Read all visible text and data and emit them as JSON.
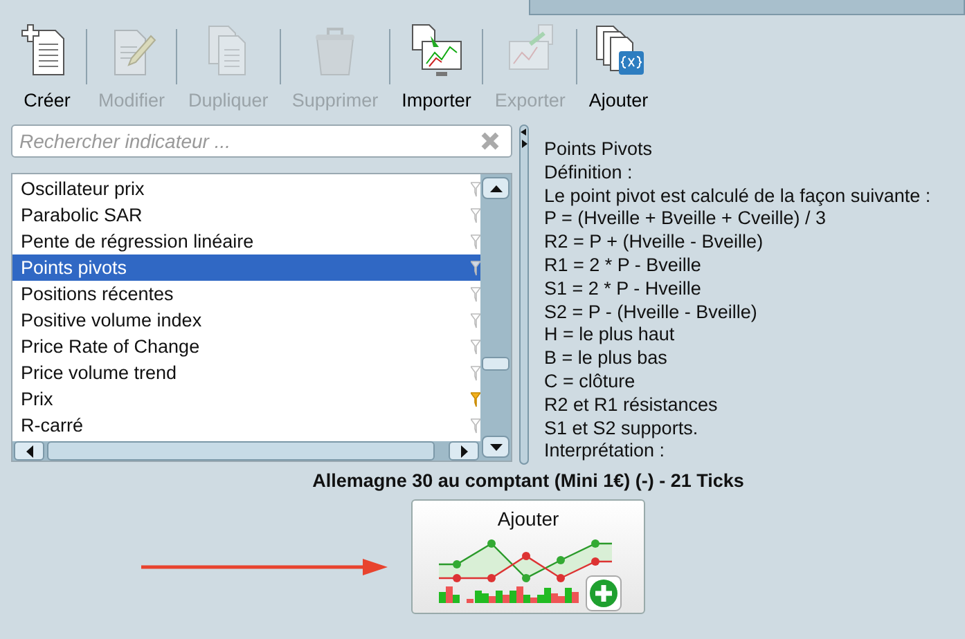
{
  "toolbar": [
    {
      "label": "Créer",
      "disabled": false
    },
    {
      "label": "Modifier",
      "disabled": true
    },
    {
      "label": "Dupliquer",
      "disabled": true
    },
    {
      "label": "Supprimer",
      "disabled": true
    },
    {
      "label": "Importer",
      "disabled": false
    },
    {
      "label": "Exporter",
      "disabled": true
    },
    {
      "label": "Ajouter",
      "disabled": false
    }
  ],
  "search": {
    "placeholder": "Rechercher indicateur ..."
  },
  "indicators": [
    {
      "name": "Oscillateur prix",
      "selected": false,
      "favorite": false
    },
    {
      "name": "Parabolic SAR",
      "selected": false,
      "favorite": false
    },
    {
      "name": "Pente de régression linéaire",
      "selected": false,
      "favorite": false
    },
    {
      "name": "Points pivots",
      "selected": true,
      "favorite": false
    },
    {
      "name": "Positions récentes",
      "selected": false,
      "favorite": false
    },
    {
      "name": "Positive volume index",
      "selected": false,
      "favorite": false
    },
    {
      "name": "Price Rate of Change",
      "selected": false,
      "favorite": false
    },
    {
      "name": "Price volume trend",
      "selected": false,
      "favorite": false
    },
    {
      "name": "Prix",
      "selected": false,
      "favorite": true
    },
    {
      "name": "R-carré",
      "selected": false,
      "favorite": false
    }
  ],
  "description": [
    "Points Pivots",
    "Définition :",
    "Le point pivot est calculé de la façon suivante :",
    "P = (Hveille + Bveille + Cveille) / 3",
    "R2 = P + (Hveille - Bveille)",
    "R1 = 2 * P - Bveille",
    "S1 = 2 * P - Hveille",
    "S2 = P - (Hveille - Bveille)",
    "H = le plus haut",
    "B = le plus bas",
    "C = clôture",
    "R2 et R1 résistances",
    "S1 et S2 supports.",
    "Interprétation :"
  ],
  "instrument": "Allemagne 30 au comptant (Mini 1€) (-) - 21 Ticks",
  "add_button": {
    "label": "Ajouter"
  }
}
